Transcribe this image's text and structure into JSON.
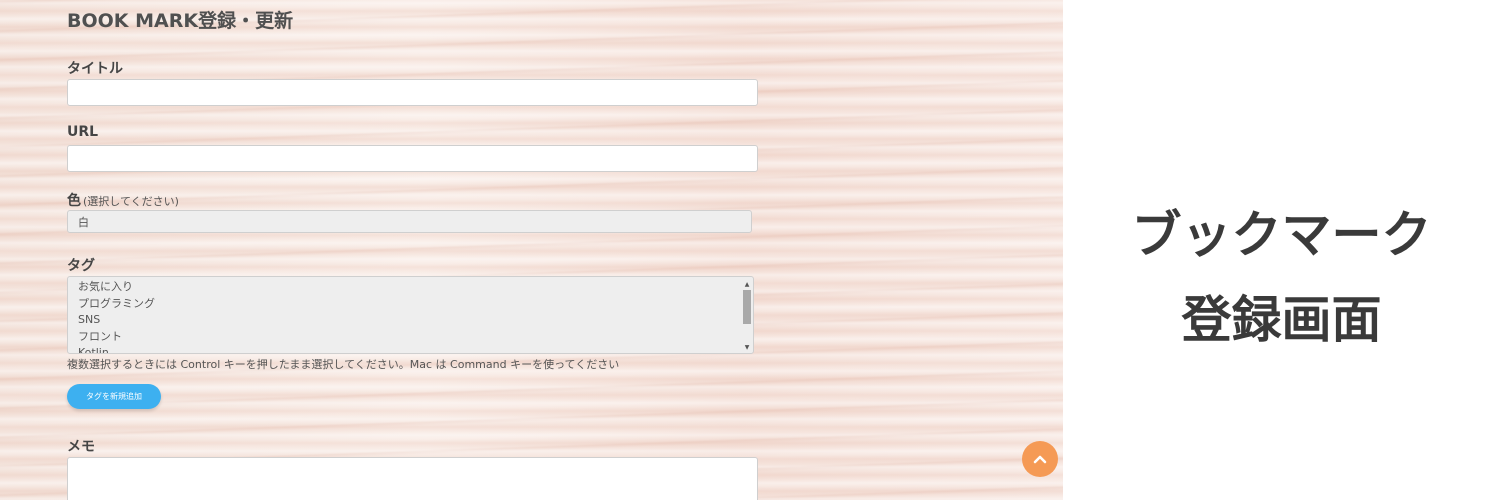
{
  "page": {
    "title": "BOOK MARK登録・更新"
  },
  "form": {
    "title_label": "タイトル",
    "title_value": "",
    "url_label": "URL",
    "url_value": "",
    "color_label": "色",
    "color_hint": "(選択してください)",
    "color_selected": "白",
    "tag_label": "タグ",
    "tag_options": [
      "お気に入り",
      "プログラミング",
      "SNS",
      "フロント",
      "Kotlin"
    ],
    "tag_help": "複数選択するときには Control キーを押したまま選択してください。Mac は Command キーを使ってください",
    "add_tag_button": "タグを新規追加",
    "memo_label": "メモ",
    "memo_value": ""
  },
  "banner": {
    "line1": "ブックマーク",
    "line2": "登録画面"
  },
  "colors": {
    "accent_button": "#3db0f0",
    "scroll_top": "#f59a55",
    "headline": "#3a3a3a"
  },
  "icons": {
    "scroll_top": "chevron-up-icon"
  }
}
